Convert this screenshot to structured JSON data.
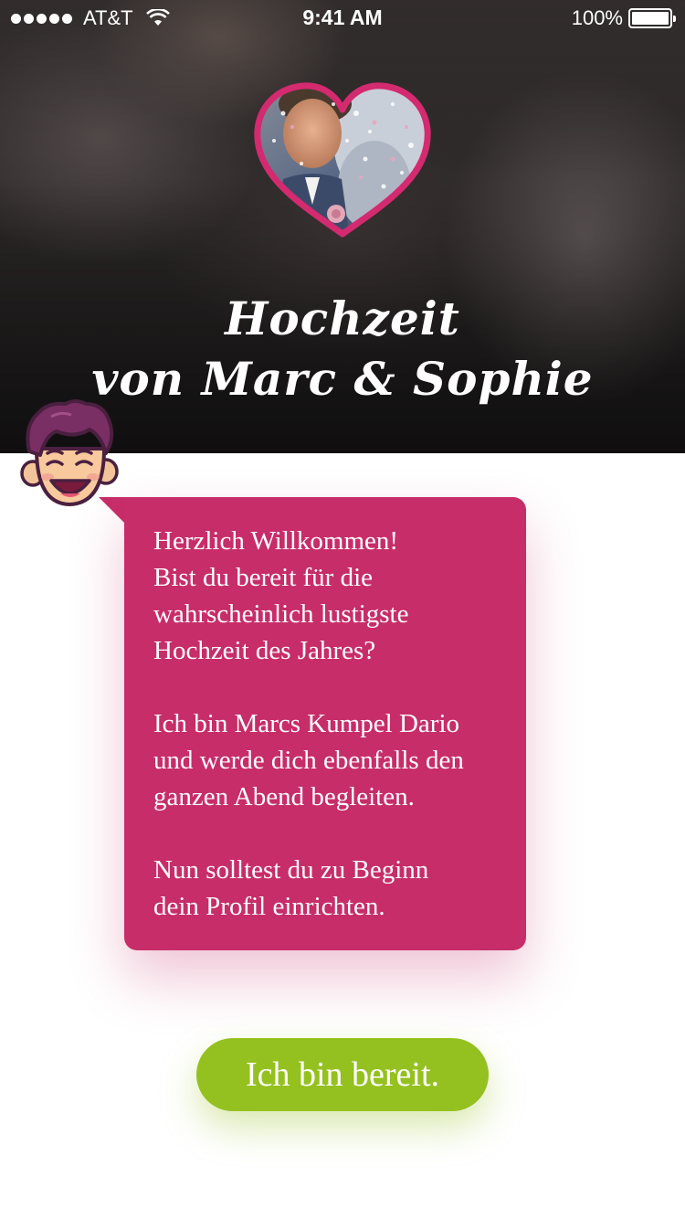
{
  "status_bar": {
    "carrier": "AT&T",
    "time": "9:41 AM",
    "battery": "100%"
  },
  "header": {
    "title_line1": "Hochzeit",
    "title_line2": "von Marc & Sophie",
    "heart_border_color": "#d42a6f"
  },
  "message": {
    "paragraph1_line1": "Herzlich Willkommen!",
    "paragraph1_line2": "Bist du bereit für die",
    "paragraph1_line3": "wahrscheinlich lustigste",
    "paragraph1_line4": "Hochzeit des Jahres?",
    "paragraph2_line1": "Ich bin Marcs Kumpel Dario",
    "paragraph2_line2": "und werde dich ebenfalls den",
    "paragraph2_line3": "ganzen Abend begleiten.",
    "paragraph3_line1": "Nun solltest du zu Beginn",
    "paragraph3_line2": "dein Profil einrichten.",
    "bubble_color": "#c72d69"
  },
  "cta": {
    "label": "Ich bin bereit.",
    "color": "#94c11f"
  },
  "icons": {
    "signal": "signal-dots-icon",
    "wifi": "wifi-icon",
    "battery": "battery-icon",
    "avatar": "dario-avatar-icon",
    "heart_photo": "couple-heart-photo"
  }
}
